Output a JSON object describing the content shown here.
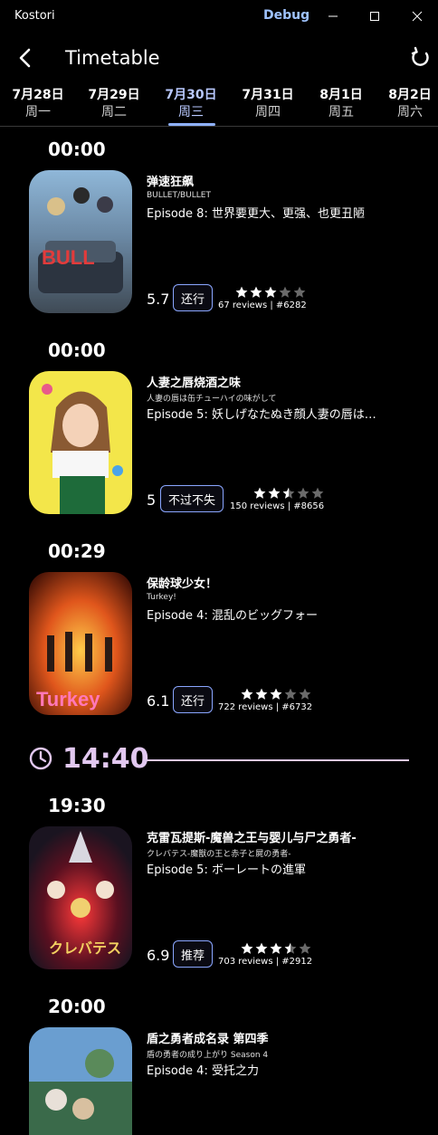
{
  "window": {
    "app_title": "Kostori",
    "debug_label": "Debug"
  },
  "header": {
    "title": "Timetable"
  },
  "tabs": [
    {
      "date": "7月28日",
      "weekday": "周一"
    },
    {
      "date": "7月29日",
      "weekday": "周二"
    },
    {
      "date": "7月30日",
      "weekday": "周三",
      "active": true
    },
    {
      "date": "7月31日",
      "weekday": "周四"
    },
    {
      "date": "8月1日",
      "weekday": "周五"
    },
    {
      "date": "8月2日",
      "weekday": "周六"
    }
  ],
  "now_marker": {
    "time": "14:40"
  },
  "entries": [
    {
      "time": "00:00",
      "title": "弹速狂飙",
      "subtitle": "BULLET/BULLET",
      "episode": "Episode 8: 世界要更大、更强、也更丑陋",
      "score": "5.7",
      "verdict": "还行",
      "stars": 3,
      "reviews": "67 reviews | #6282"
    },
    {
      "time": "00:00",
      "title": "人妻之唇烧酒之味",
      "subtitle": "人妻の唇は缶チューハイの味がして",
      "episode": "Episode 5: 妖しげなたぬき顔人妻の唇は…",
      "score": "5",
      "verdict": "不过不失",
      "stars": 2.5,
      "reviews": "150 reviews | #8656"
    },
    {
      "time": "00:29",
      "title": "保龄球少女！",
      "subtitle": "Turkey!",
      "episode": "Episode 4: 混乱のビッグフォー",
      "score": "6.1",
      "verdict": "还行",
      "stars": 3,
      "reviews": "722 reviews | #6732"
    },
    {
      "time": "19:30",
      "title": "克雷瓦提斯-魔兽之王与婴儿与尸之勇者-",
      "subtitle": "クレバテス-魔獣の王と赤子と屍の勇者-",
      "episode": "Episode 5: ボーレートの進軍",
      "score": "6.9",
      "verdict": "推荐",
      "stars": 3.5,
      "reviews": "703 reviews | #2912"
    },
    {
      "time": "20:00",
      "title": "盾之勇者成名录 第四季",
      "subtitle": "盾の勇者の成り上がり Season 4",
      "episode": "Episode 4: 受托之力",
      "score": "",
      "verdict": "",
      "stars": 0,
      "reviews": ""
    }
  ],
  "colors": {
    "accent": "#8fb1ff",
    "now": "#e2c8f0",
    "background": "#000000"
  },
  "icons": {
    "back": "arrow-left-icon",
    "refresh": "refresh-icon",
    "now": "clock-icon"
  }
}
